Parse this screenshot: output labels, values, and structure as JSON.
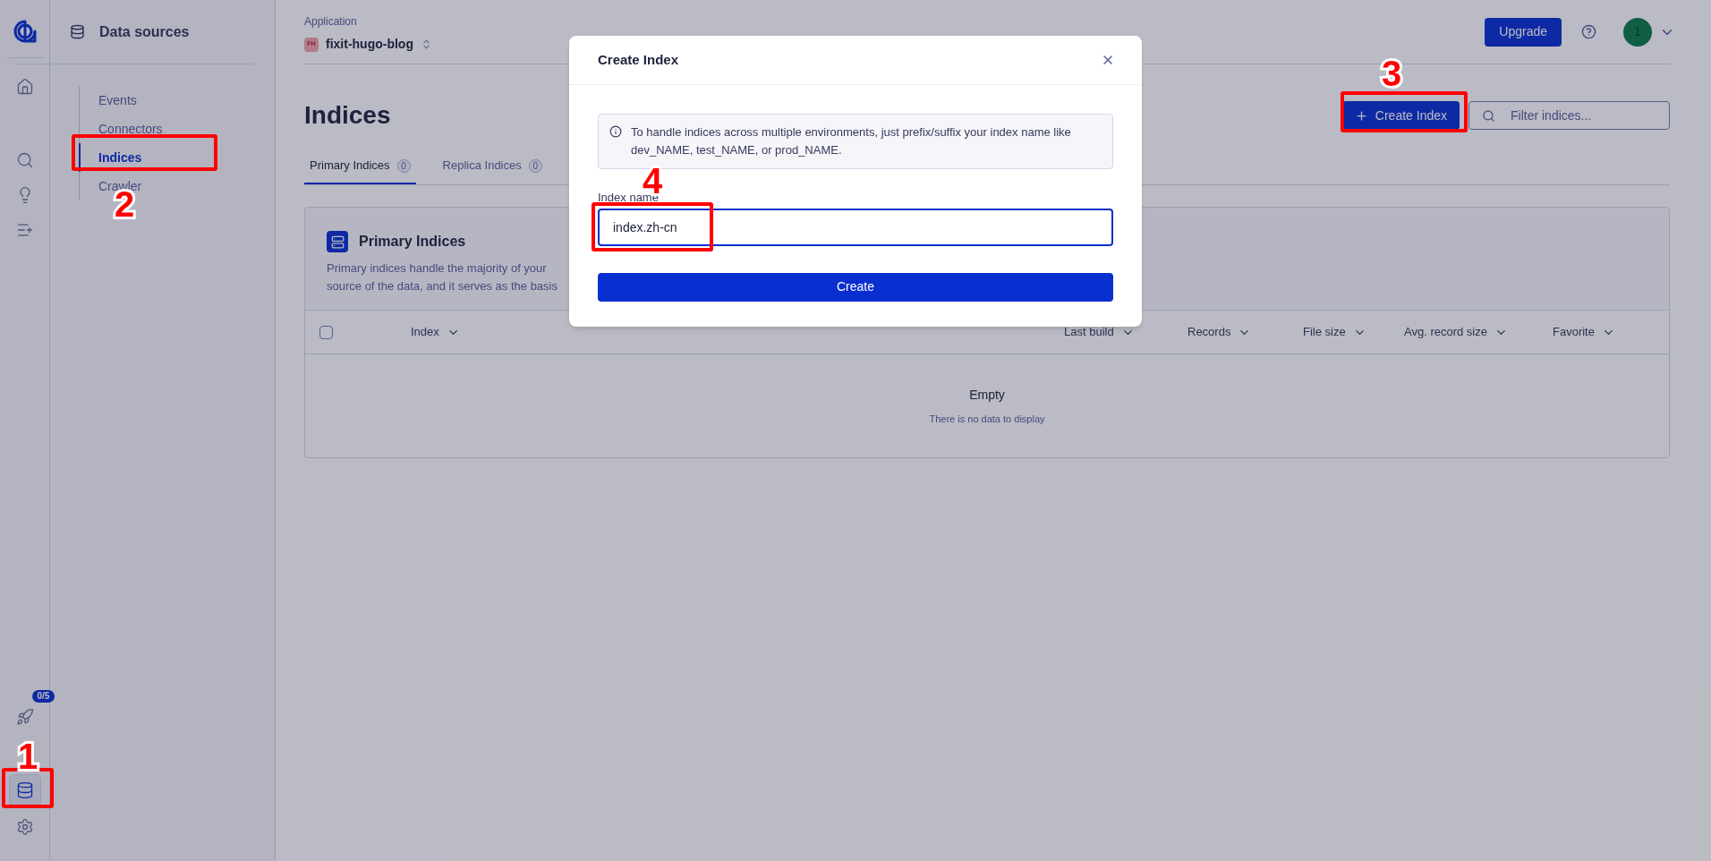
{
  "rail": {
    "items": [
      {
        "selected": false
      },
      {
        "selected": false
      },
      {
        "selected": false
      },
      {
        "selected": false
      },
      {
        "selected": false,
        "badge": "0/5"
      },
      {
        "selected": true
      },
      {
        "selected": false
      }
    ]
  },
  "sidebar": {
    "title": "Data sources",
    "items": [
      {
        "label": "Events",
        "selected": false
      },
      {
        "label": "Connectors",
        "selected": false
      },
      {
        "label": "Indices",
        "selected": true
      },
      {
        "label": "Crawler",
        "selected": false
      }
    ]
  },
  "header": {
    "app_label": "Application",
    "app_badge": "FH",
    "app_name": "fixit-hugo-blog",
    "upgrade": "Upgrade",
    "avatar": "1"
  },
  "page": {
    "title": "Indices",
    "create_button": "Create Index",
    "filter_placeholder": "Filter indices...",
    "tabs": [
      {
        "label": "Primary Indices",
        "count": "0",
        "selected": true
      },
      {
        "label": "Replica Indices",
        "count": "0",
        "selected": false
      }
    ]
  },
  "card": {
    "title": "Primary Indices",
    "description_lines": [
      "Primary indices handle the majority of your",
      "source of the data, and it serves as the basis"
    ],
    "select_all_checked": false,
    "columns": [
      "Index",
      "Last build",
      "Records",
      "File size",
      "Avg. record size",
      "Favorite"
    ],
    "empty_title": "Empty",
    "empty_text": "There is no data to display"
  },
  "modal": {
    "title": "Create Index",
    "info": "To handle indices across multiple environments, just prefix/suffix your index name like dev_NAME, test_NAME, or prod_NAME.",
    "field_label": "Index name",
    "field_value": "index.zh-cn",
    "submit": "Create"
  },
  "annotations": [
    {
      "number": "1"
    },
    {
      "number": "2"
    },
    {
      "number": "3"
    },
    {
      "number": "4"
    }
  ]
}
